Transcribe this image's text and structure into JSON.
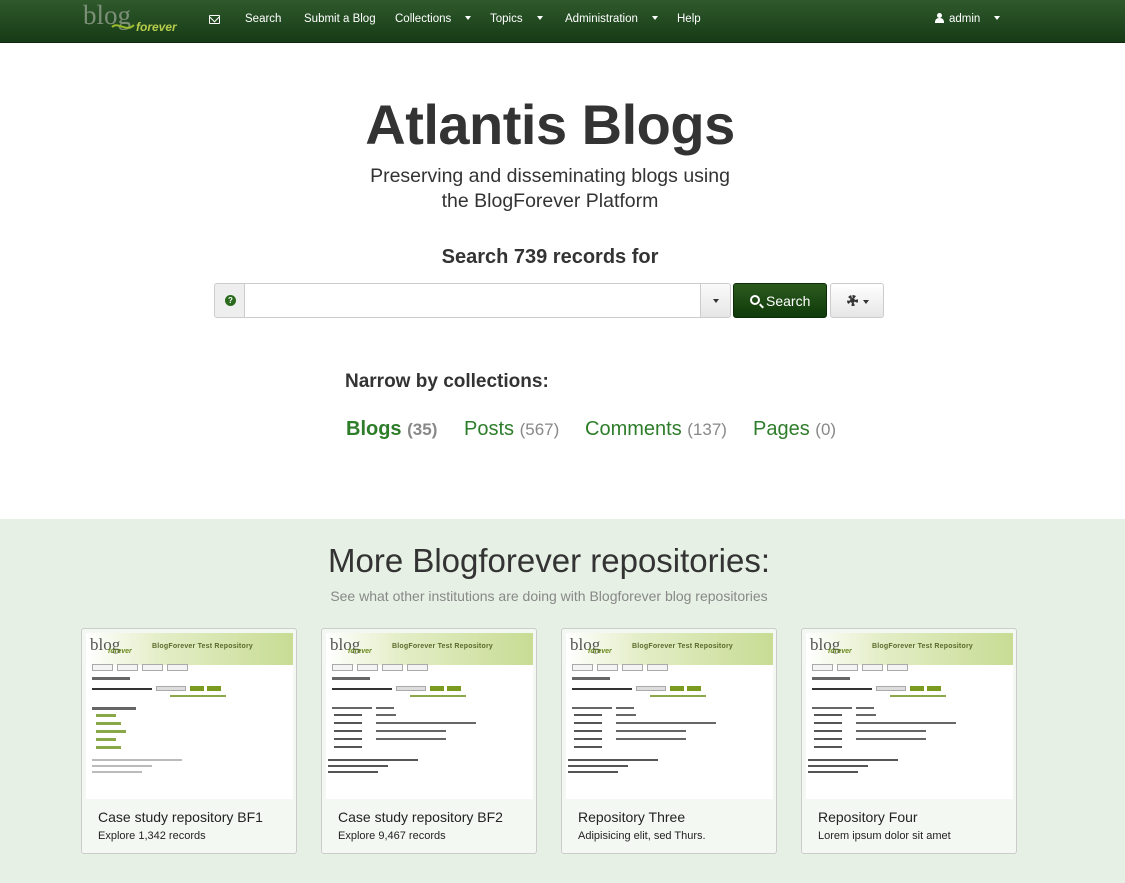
{
  "navbar": {
    "logo_text": "blog forever",
    "search": "Search",
    "submit_blog": "Submit a Blog",
    "collections": "Collections",
    "topics": "Topics",
    "administration": "Administration",
    "help": "Help",
    "user": "admin"
  },
  "hero": {
    "title": "Atlantis Blogs",
    "subtitle_line1": "Preserving and disseminating blogs using",
    "subtitle_line2": "the BlogForever Platform",
    "search_heading": "Search 739 records for"
  },
  "search": {
    "query": "",
    "button_label": "Search"
  },
  "collections": {
    "heading": "Narrow by collections:",
    "items": [
      {
        "name": "Blogs",
        "count": "(35)"
      },
      {
        "name": "Posts",
        "count": "(567)"
      },
      {
        "name": "Comments",
        "count": "(137)"
      },
      {
        "name": "Pages",
        "count": "(0)"
      }
    ]
  },
  "repositories": {
    "title": "More Blogforever repositories:",
    "subtitle": "See what other institutions are doing with Blogforever blog repositories",
    "thumb_header": "BlogForever Test Repository",
    "items": [
      {
        "title": "Case study repository BF1",
        "description": "Explore 1,342 records"
      },
      {
        "title": "Case study repository BF2",
        "description": "Explore 9,467 records"
      },
      {
        "title": "Repository Three",
        "description": "Adipisicing elit, sed Thurs."
      },
      {
        "title": "Repository Four",
        "description": "Lorem ipsum dolor sit amet"
      }
    ]
  },
  "colors": {
    "navbar": "#1f4a1c",
    "link_green": "#2e7d2a",
    "section_bg": "#e6f0e4"
  }
}
